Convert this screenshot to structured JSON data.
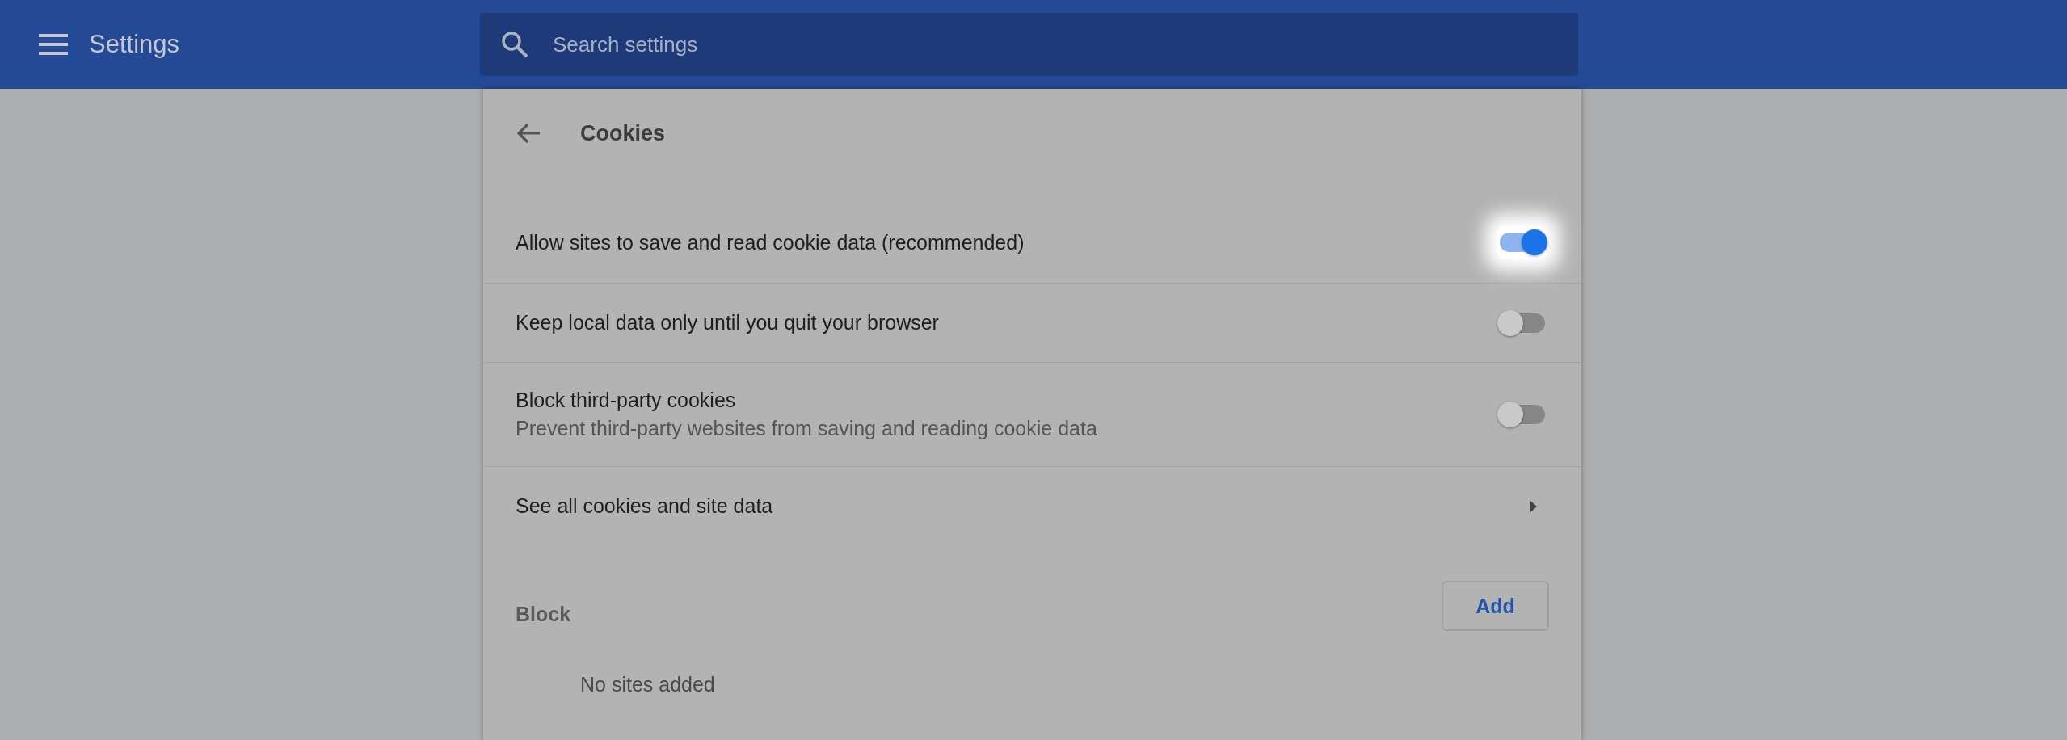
{
  "header": {
    "title": "Settings",
    "search": {
      "placeholder": "Search settings"
    }
  },
  "page": {
    "title": "Cookies",
    "rows": [
      {
        "kind": "toggle",
        "label": "Allow sites to save and read cookie data (recommended)",
        "on": true,
        "focused": true
      },
      {
        "kind": "toggle",
        "label": "Keep local data only until you quit your browser",
        "on": false,
        "focused": false
      },
      {
        "kind": "toggle",
        "label": "Block third-party cookies",
        "sublabel": "Prevent third-party websites from saving and reading cookie data",
        "on": false,
        "focused": false
      },
      {
        "kind": "link",
        "label": "See all cookies and site data"
      }
    ],
    "sections": [
      {
        "title": "Block",
        "button": "Add",
        "empty": "No sites added"
      }
    ]
  }
}
